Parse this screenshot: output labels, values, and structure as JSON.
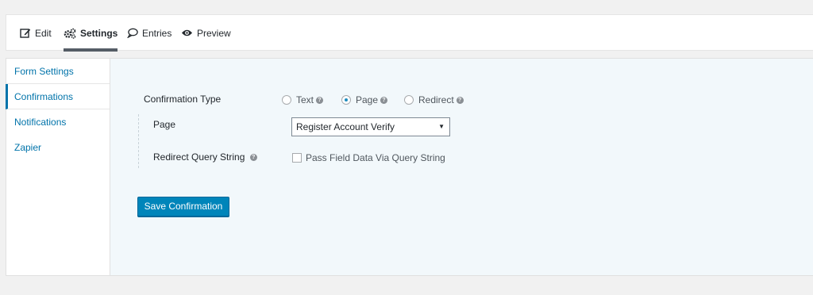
{
  "tabs": {
    "edit": "Edit",
    "settings": "Settings",
    "entries": "Entries",
    "preview": "Preview"
  },
  "sidebar": {
    "items": [
      {
        "label": "Form Settings"
      },
      {
        "label": "Confirmations"
      },
      {
        "label": "Notifications"
      },
      {
        "label": "Zapier"
      }
    ]
  },
  "form": {
    "confirmation_type_label": "Confirmation Type",
    "radio_options": [
      {
        "label": "Text",
        "checked": false
      },
      {
        "label": "Page",
        "checked": true
      },
      {
        "label": "Redirect",
        "checked": false
      }
    ],
    "page_label": "Page",
    "page_select_value": "Register Account Verify",
    "redirect_query_label": "Redirect Query String",
    "pass_field_label": "Pass Field Data Via Query String",
    "save_button": "Save Confirmation"
  },
  "colors": {
    "accent": "#0073aa",
    "button": "#0085ba",
    "content_bg": "#f2f8fb"
  }
}
